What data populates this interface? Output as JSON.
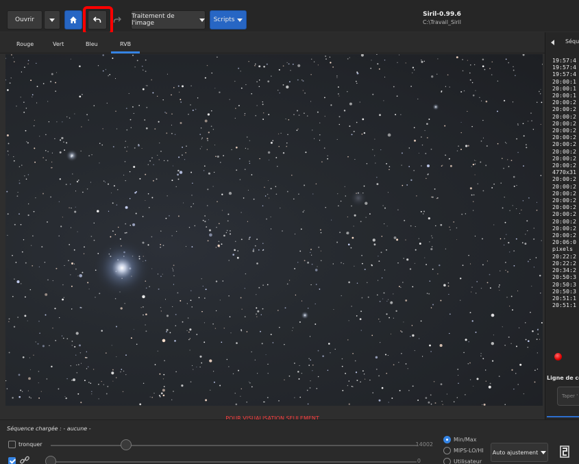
{
  "header": {
    "open_label": "Ouvrir",
    "image_processing_label": "Traitement de l'image",
    "scripts_label": "Scripts",
    "app_title": "Siril-0.99.6",
    "working_dir": "C:\\Travail_Siril",
    "icons": [
      "chevron-down-icon",
      "home-icon",
      "undo-icon",
      "redo-icon"
    ]
  },
  "tabs": [
    "Rouge",
    "Vert",
    "Bleu",
    "RVB"
  ],
  "active_tab": "RVB",
  "preview_notice": "POUR VISUALISATION SEULEMENT",
  "right_panel": {
    "header_label": "Séqu",
    "log_lines": [
      "19:57:4",
      "19:57:4",
      "19:57:4",
      "20:00:1",
      "20:00:1",
      "20:00:1",
      "20:00:2",
      "20:00:2",
      "20:00:2",
      "20:00:2",
      "20:00:2",
      "20:00:2",
      "20:00:2",
      "20:00:2",
      "20:00:2",
      "20:00:2",
      "4770x31",
      "20:00:2",
      "20:00:2",
      "20:00:2",
      "20:00:2",
      "20:00:2",
      "20:00:2",
      "20:00:2",
      "20:00:2",
      "20:00:2",
      "20:06:0",
      "pixels",
      "20:22:2",
      "20:22:2",
      "20:34:2",
      "20:50:3",
      "20:50:3",
      "20:50:3",
      "20:51:1",
      "20:51:1"
    ],
    "command_line_label": "Ligne de co",
    "command_placeholder": "Taper '"
  },
  "bottom": {
    "sequence_label": "Séquence chargée : - aucune -",
    "crop_label": "tronquer",
    "slider_max_value": "14002",
    "slider_min_value": "0",
    "radio_options": [
      "Min/Max",
      "MIPS-LO/HI",
      "Utilisateur"
    ],
    "radio_selected": "Min/Max",
    "auto_adjust_label": "Auto ajustement"
  }
}
